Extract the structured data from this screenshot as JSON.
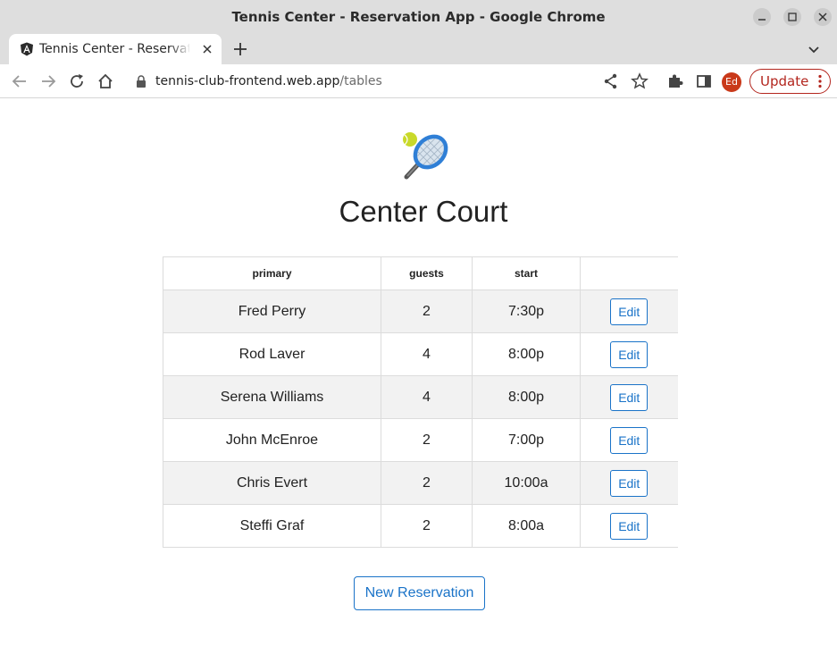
{
  "window": {
    "title": "Tennis Center - Reservation App - Google Chrome"
  },
  "tab": {
    "title": "Tennis Center - Reservation App",
    "favicon": "angular-icon"
  },
  "toolbar": {
    "url_host": "tennis-club-frontend.web.app",
    "url_path": "/tables",
    "profile_initials": "Ed",
    "update_label": "Update"
  },
  "page": {
    "logo": "tennis-racket-icon",
    "title": "Center Court",
    "columns": [
      "primary",
      "guests",
      "start",
      ""
    ],
    "rows": [
      {
        "primary": "Fred Perry",
        "guests": "2",
        "start": "7:30p",
        "action": "Edit"
      },
      {
        "primary": "Rod Laver",
        "guests": "4",
        "start": "8:00p",
        "action": "Edit"
      },
      {
        "primary": "Serena Williams",
        "guests": "4",
        "start": "8:00p",
        "action": "Edit"
      },
      {
        "primary": "John McEnroe",
        "guests": "2",
        "start": "7:00p",
        "action": "Edit"
      },
      {
        "primary": "Chris Evert",
        "guests": "2",
        "start": "10:00a",
        "action": "Edit"
      },
      {
        "primary": "Steffi Graf",
        "guests": "2",
        "start": "8:00a",
        "action": "Edit"
      }
    ],
    "new_reservation_label": "New Reservation"
  },
  "colors": {
    "accent": "#1a73c8",
    "update_red": "#b3261e",
    "avatar": "#c9391a",
    "row_stripe": "#f2f2f2"
  }
}
